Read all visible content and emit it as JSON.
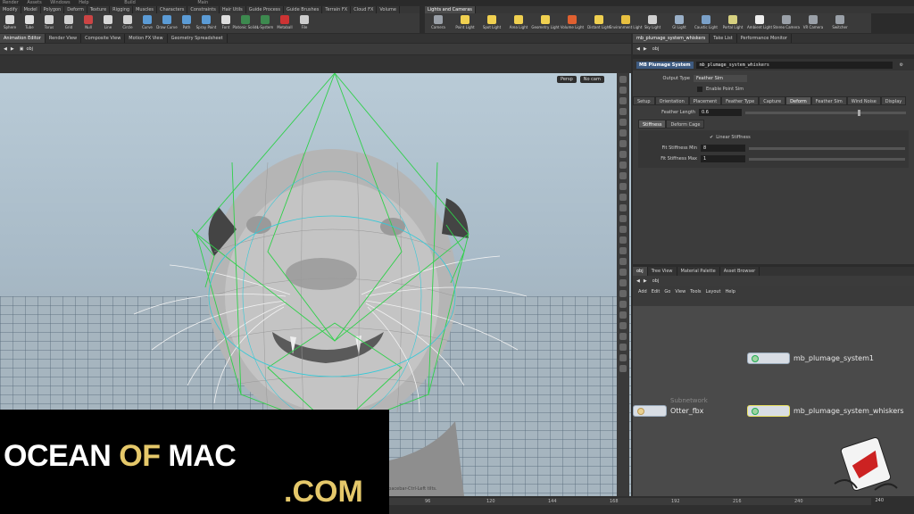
{
  "menubar": [
    "Render",
    "Assets",
    "Windows",
    "Help",
    "Build",
    "Main"
  ],
  "shelf_tabs_left": [
    "Modify",
    "Model",
    "Polygon",
    "Deform",
    "Texture",
    "Rigging",
    "Muscles",
    "Characters",
    "Constraints",
    "Hair Utils",
    "Guide Process",
    "Guide Brushes",
    "Terrain FX",
    "Cloud FX",
    "Volume"
  ],
  "shelf_tabs_right": [
    "Lights and Cameras"
  ],
  "tools_left": [
    {
      "label": "Sphere",
      "color": "#d9d9d9"
    },
    {
      "label": "Tube",
      "color": "#e0e0e0"
    },
    {
      "label": "Torus",
      "color": "#d5d5d5"
    },
    {
      "label": "Grid",
      "color": "#d0d0d0"
    },
    {
      "label": "Null",
      "color": "#cc4444"
    },
    {
      "label": "Line",
      "color": "#d6d6d6"
    },
    {
      "label": "Circle",
      "color": "#d2d2d2"
    },
    {
      "label": "Curve",
      "color": "#5b9bd5"
    },
    {
      "label": "Draw Curve",
      "color": "#5b9bd5"
    },
    {
      "label": "Path",
      "color": "#5b9bd5"
    },
    {
      "label": "Spray Paint",
      "color": "#5b9bd5"
    },
    {
      "label": "Font",
      "color": "#dddddd"
    },
    {
      "label": "Platonic Solids",
      "color": "#3d8a4f"
    },
    {
      "label": "L-System",
      "color": "#3d8a4f"
    },
    {
      "label": "Metaball",
      "color": "#cc3333"
    },
    {
      "label": "File",
      "color": "#cccccc"
    }
  ],
  "tools_right": [
    {
      "label": "Camera",
      "color": "#9aa0a8"
    },
    {
      "label": "Point Light",
      "color": "#f0d050"
    },
    {
      "label": "Spot Light",
      "color": "#f0d050"
    },
    {
      "label": "Area Light",
      "color": "#f0d050"
    },
    {
      "label": "Geometry Light",
      "color": "#f0d050"
    },
    {
      "label": "Volume Light",
      "color": "#e06030"
    },
    {
      "label": "Distant Light",
      "color": "#f0d050"
    },
    {
      "label": "Environment Light",
      "color": "#e8c040"
    },
    {
      "label": "Sky Light",
      "color": "#d0d0d0"
    },
    {
      "label": "GI Light",
      "color": "#9ab0c8"
    },
    {
      "label": "Caustic Light",
      "color": "#7aa0c8"
    },
    {
      "label": "Portal Light",
      "color": "#d6d080"
    },
    {
      "label": "Ambient Light",
      "color": "#eeeeee"
    },
    {
      "label": "Stereo Camera",
      "color": "#9aa0a8"
    },
    {
      "label": "VR Camera",
      "color": "#9aa0a8"
    },
    {
      "label": "Switcher",
      "color": "#9aa0a8"
    }
  ],
  "viewer_tabs": [
    "Animation Editor",
    "Render View",
    "Composite View",
    "Motion FX View",
    "Geometry Spreadsheet"
  ],
  "viewer_path": "obj",
  "viewport": {
    "persp": "Persp",
    "cam": "No cam"
  },
  "param_tabs_top": [
    "mb_plumage_system_whiskers",
    "Take List",
    "Performance Monitor"
  ],
  "param_path": "obj",
  "node": {
    "type": "MB Plumage System",
    "name": "mb_plumage_system_whiskers"
  },
  "output_type": {
    "label": "Output Type",
    "value": "Feather Sim"
  },
  "enable_point_sim": "Enable Point Sim",
  "param_tabs": [
    "Setup",
    "Orientation",
    "Placement",
    "Feather Type",
    "Capture",
    "Deform",
    "Feather Sim",
    "Wind Noise",
    "Display"
  ],
  "feather_length": {
    "label": "Feather Length",
    "value": "0.6",
    "fraction": 0.7
  },
  "sub_tabs": [
    "Stiffness",
    "Deform Cage"
  ],
  "linear_stiffness": "Linear Stiffness",
  "fit_min": {
    "label": "Fit Stiffness Min",
    "value": "8"
  },
  "fit_max": {
    "label": "Fit Stiffness Max",
    "value": "1"
  },
  "network_tabs": [
    "obj",
    "Tree View",
    "Material Palette",
    "Asset Browser"
  ],
  "network_path": "obj",
  "network_menu": [
    "Add",
    "Edit",
    "Go",
    "View",
    "Tools",
    "Layout",
    "Help"
  ],
  "nodes": [
    {
      "name": "mb_plumage_system1"
    },
    {
      "name": "mb_plumage_system_whiskers"
    },
    {
      "name": "Otter_fbx",
      "subtitle": "Subnetwork"
    }
  ],
  "timeline_ticks": [
    "96",
    "120",
    "144",
    "168",
    "192",
    "216",
    "240"
  ],
  "frame_end": "240",
  "status_hint": "Spacebar-Ctrl-Left tilts.",
  "watermark": {
    "ocean": "OCEAN",
    "of": "OF",
    "mac": "MAC",
    "com": ".COM"
  }
}
